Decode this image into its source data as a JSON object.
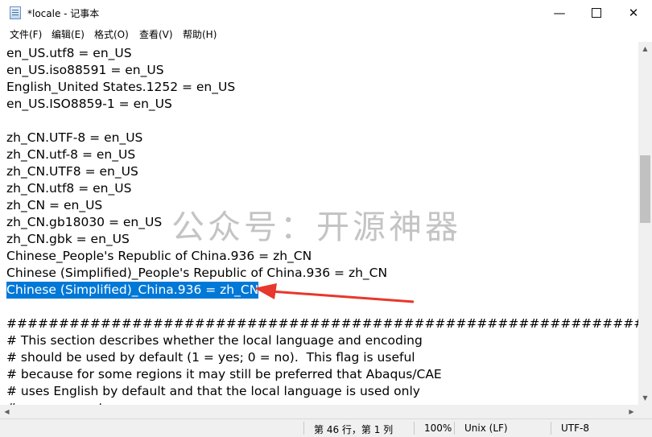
{
  "window": {
    "title": "*locale - 记事本"
  },
  "menu": {
    "items": [
      "文件(F)",
      "编辑(E)",
      "格式(O)",
      "查看(V)",
      "帮助(H)"
    ]
  },
  "editor": {
    "lines": [
      "en_US.utf8 = en_US",
      "en_US.iso88591 = en_US",
      "English_United States.1252 = en_US",
      "en_US.ISO8859-1 = en_US",
      "",
      "zh_CN.UTF-8 = en_US",
      "zh_CN.utf-8 = en_US",
      "zh_CN.UTF8 = en_US",
      "zh_CN.utf8 = en_US",
      "zh_CN = en_US",
      "zh_CN.gb18030 = en_US",
      "zh_CN.gbk = en_US",
      "Chinese_People's Republic of China.936 = zh_CN",
      "Chinese (Simplified)_People's Republic of China.936 = zh_CN",
      "Chinese (Simplified)_China.936 = zh_CN",
      "",
      "##################################################################",
      "# This section describes whether the local language and encoding",
      "# should be used by default (1 = yes; 0 = no).  This flag is useful",
      "# because for some regions it may still be preferred that Abaqus/CAE",
      "# uses English by default and that the local language is used only",
      "# upon request."
    ],
    "selected_line_index": 14
  },
  "overlay": {
    "watermark": "公众号：开源神器",
    "arrow_color": "#e8372b"
  },
  "status": {
    "position": "第 46 行，第 1 列",
    "zoom": "100%",
    "line_ending": "Unix (LF)",
    "encoding": "UTF-8"
  },
  "colors": {
    "selection": "#0078d7"
  }
}
